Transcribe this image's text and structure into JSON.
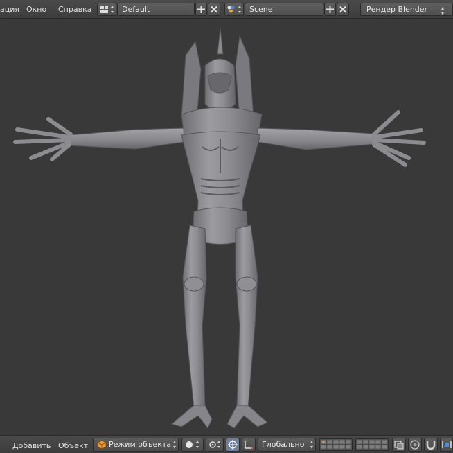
{
  "top_menu": {
    "items": [
      "ация",
      "Окно",
      "Справка"
    ]
  },
  "layout": {
    "value": "Default"
  },
  "scene": {
    "value": "Scene"
  },
  "render_engine": {
    "value": "Рендер Blender"
  },
  "bottom_menu": {
    "items": [
      "Добавить",
      "Объект"
    ]
  },
  "mode": {
    "value": "Режим объекта"
  },
  "orientation": {
    "value": "Глобально"
  },
  "viewport": {
    "object": "humanoid-monster-model"
  }
}
